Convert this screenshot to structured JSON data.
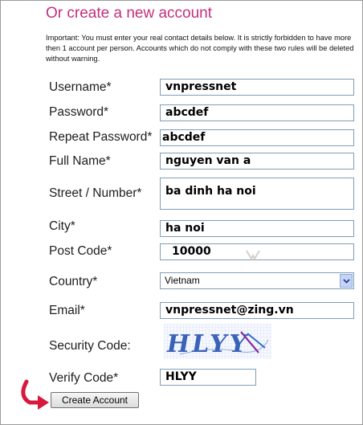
{
  "title": "Or create a new account",
  "notice": "Important: You must enter your real contact details below. It is strictly forbidden to have more then 1 account per person. Accounts which do not comply with these two rules will be deleted without warning.",
  "form": {
    "username": {
      "label": "Username*",
      "value": "vnpressnet"
    },
    "password": {
      "label": "Password*",
      "value": "abcdef"
    },
    "repeat_password": {
      "label": "Repeat Password*",
      "value": "abcdef"
    },
    "full_name": {
      "label": "Full Name*",
      "value": "nguyen van a"
    },
    "street": {
      "label": "Street / Number*",
      "value": "ba dinh ha noi"
    },
    "city": {
      "label": "City*",
      "value": "ha noi"
    },
    "post_code": {
      "label": "Post Code*",
      "value": "10000"
    },
    "country": {
      "label": "Country*",
      "value": "Vietnam"
    },
    "email": {
      "label": "Email*",
      "value": "vnpressnet@zing.vn"
    },
    "security_code": {
      "label": "Security Code:",
      "captcha_text": "HLYY"
    },
    "verify_code": {
      "label": "Verify Code*",
      "value": "HLYY"
    }
  },
  "submit_label": "Create Account",
  "colors": {
    "title": "#c2307d",
    "arrow": "#d8183c",
    "select_arrow": "#c4d3f6",
    "captcha_text": "#3a62b8"
  }
}
